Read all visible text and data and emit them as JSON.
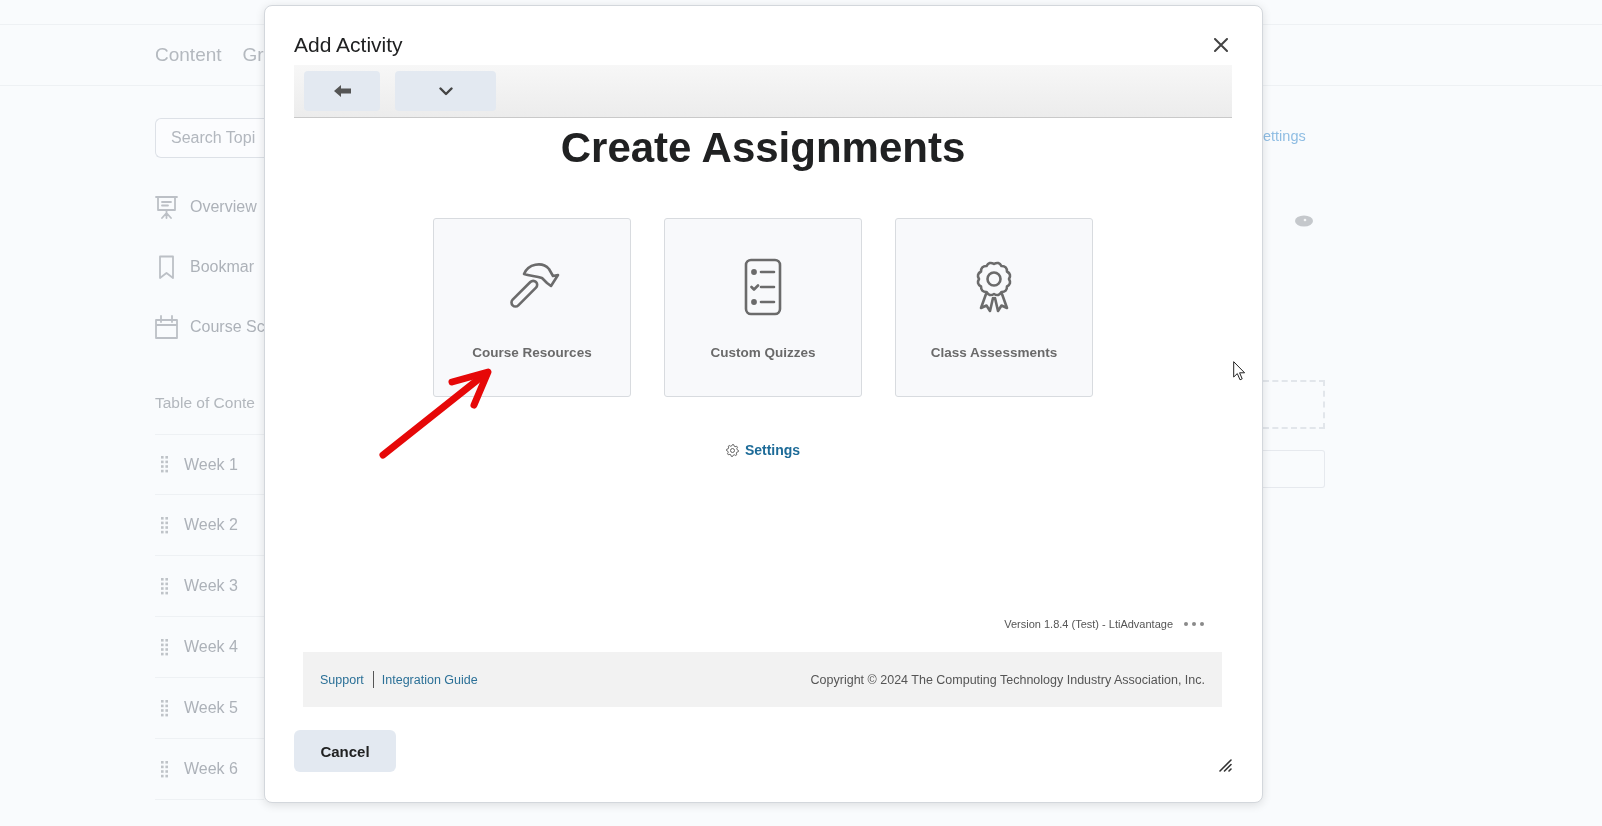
{
  "background": {
    "nav": [
      "Content",
      "Gr"
    ],
    "search": {
      "placeholder": "Search Topi"
    },
    "sidebar": {
      "items": [
        {
          "label": "Overview"
        },
        {
          "label": "Bookmar"
        },
        {
          "label": "Course Sc"
        }
      ]
    },
    "toc": {
      "heading": "Table of Conte",
      "items": [
        {
          "label": "Week 1"
        },
        {
          "label": "Week 2"
        },
        {
          "label": "Week 3"
        },
        {
          "label": "Week 4"
        },
        {
          "label": "Week 5"
        },
        {
          "label": "Week 6"
        }
      ]
    },
    "right_link": "ettings"
  },
  "dialog": {
    "title": "Add Activity",
    "heading": "Create Assignments",
    "cards": [
      {
        "label": "Course Resources"
      },
      {
        "label": "Custom Quizzes"
      },
      {
        "label": "Class Assessments"
      }
    ],
    "settings_link": "Settings",
    "version": "Version 1.8.4 (Test) - LtiAdvantage",
    "footer": {
      "links": [
        "Support",
        "Integration Guide"
      ],
      "copyright": "Copyright © 2024 The Computing Technology Industry Association, Inc."
    },
    "buttons": [
      "Cancel"
    ]
  }
}
